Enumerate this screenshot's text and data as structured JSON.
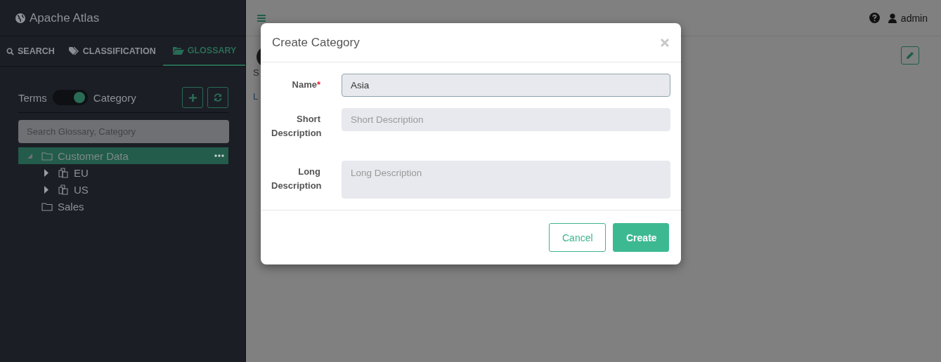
{
  "app": {
    "title": "Apache Atlas"
  },
  "tabs": [
    {
      "label": "SEARCH",
      "kind": "search",
      "selected": false
    },
    {
      "label": "CLASSIFICATION",
      "kind": "tag",
      "selected": false
    },
    {
      "label": "GLOSSARY",
      "kind": "folder",
      "selected": true
    }
  ],
  "toggle": {
    "left": "Terms",
    "right": "Category",
    "on": true
  },
  "search": {
    "placeholder": "Search Glossary, Category"
  },
  "tree": [
    {
      "label": "Customer Data",
      "kind": "folder",
      "expanded": true,
      "selected": true,
      "children": [
        {
          "label": "EU",
          "kind": "copy",
          "expanded": false,
          "selected": false
        },
        {
          "label": "US",
          "kind": "copy",
          "expanded": false,
          "selected": false
        }
      ]
    },
    {
      "label": "Sales",
      "kind": "folder",
      "selected": false
    }
  ],
  "header": {
    "user": "admin"
  },
  "background_text": [
    {
      "text": "S",
      "kind": "label"
    },
    {
      "text": "L",
      "kind": "link"
    }
  ],
  "modal": {
    "title": "Create Category",
    "fields": [
      {
        "label": "Name",
        "required_mark": "*",
        "kind": "input",
        "value": "Asia"
      },
      {
        "label": "Short Description",
        "kind": "input",
        "placeholder": "Short Description"
      },
      {
        "label": "Long Description",
        "kind": "textarea",
        "placeholder": "Long Description"
      }
    ],
    "buttons": [
      {
        "label": "Cancel",
        "kind": "secondary"
      },
      {
        "label": "Create",
        "kind": "primary"
      }
    ]
  }
}
